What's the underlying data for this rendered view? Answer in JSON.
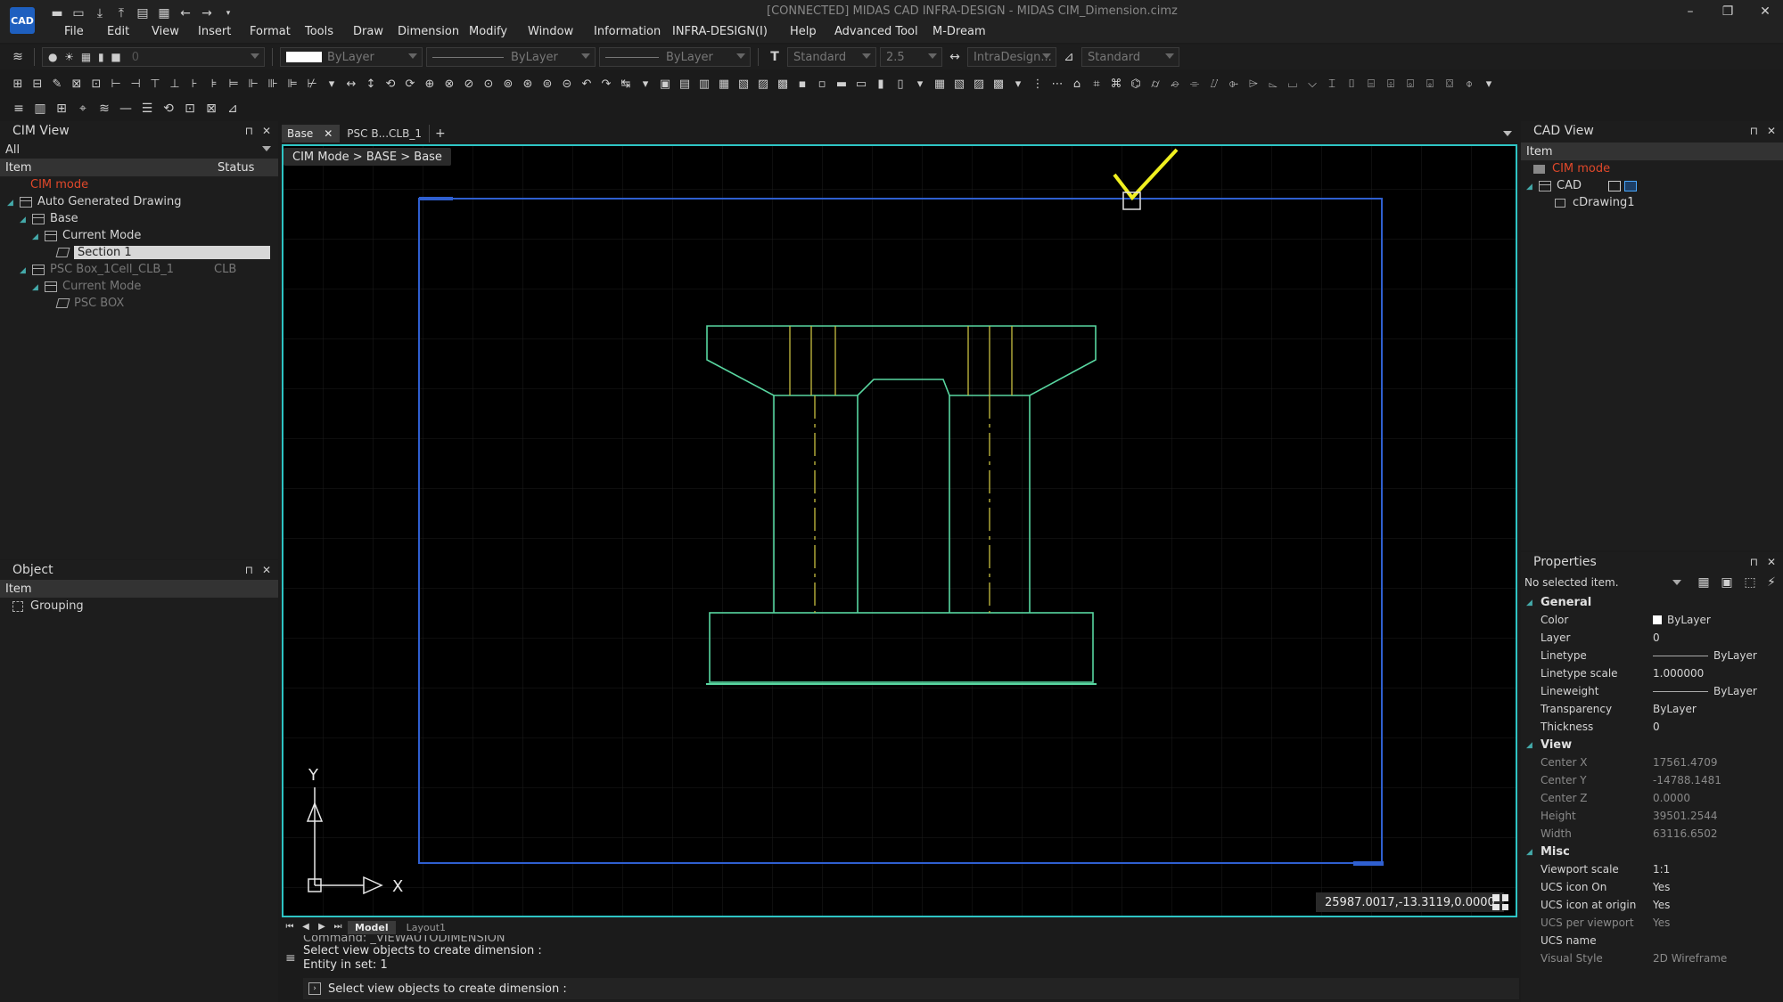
{
  "window": {
    "title": "[CONNECTED] MIDAS CAD INFRA-DESIGN - MIDAS CIM_Dimension.cimz",
    "logo": "CAD"
  },
  "menu": [
    "File",
    "Edit",
    "View",
    "Insert",
    "Format",
    "Tools",
    "Draw",
    "Dimension",
    "Modify",
    "Window",
    "Information",
    "INFRA-DESIGN(I)",
    "Help",
    "Advanced Tool",
    "M-Dream"
  ],
  "props_bar": {
    "layer_value": "0",
    "color_label": "ByLayer",
    "linetype_label": "ByLayer",
    "lineweight_label": "ByLayer",
    "text_style": "Standard",
    "text_height": "2.5",
    "dim_style": "IntraDesign...",
    "table_style": "Standard"
  },
  "cim_view": {
    "title": "CIM View",
    "filter": "All",
    "columns": {
      "item": "Item",
      "status": "Status"
    },
    "mode_label": "CIM mode",
    "tree": [
      {
        "label": "Auto Generated Drawing",
        "status": "",
        "level": 0,
        "dim": false
      },
      {
        "label": "Base",
        "status": "",
        "level": 1,
        "dim": false
      },
      {
        "label": "Current Mode",
        "status": "",
        "level": 2,
        "dim": false
      },
      {
        "label": "Section 1",
        "status": "",
        "level": 3,
        "dim": false,
        "selected": true
      },
      {
        "label": "PSC Box_1Cell_CLB_1",
        "status": "CLB",
        "level": 1,
        "dim": true
      },
      {
        "label": "Current Mode",
        "status": "",
        "level": 2,
        "dim": true
      },
      {
        "label": "PSC BOX",
        "status": "",
        "level": 3,
        "dim": true
      }
    ]
  },
  "object_panel": {
    "title": "Object",
    "column": "Item",
    "items": [
      "Grouping"
    ]
  },
  "tabs": [
    {
      "label": "Base",
      "active": true
    },
    {
      "label": "PSC B...CLB_1",
      "active": false
    }
  ],
  "add_tab": "+",
  "breadcrumb": "CIM Mode > BASE > Base",
  "coords": "25987.0017,-13.3119,0.0000",
  "ucs": {
    "x": "X",
    "y": "Y"
  },
  "layout_tabs": [
    "Model",
    "Layout1"
  ],
  "command": {
    "lines": [
      "Command: _VIEWAUTODIMENSION",
      "Select view objects to create dimension :",
      "Entity in set: 1"
    ],
    "prompt": "Select view objects to create dimension :"
  },
  "cad_view": {
    "title": "CAD View",
    "column": "Item",
    "mode_label": "CIM mode",
    "tree": [
      {
        "label": "CAD",
        "level": 0
      },
      {
        "label": "cDrawing1",
        "level": 1
      }
    ]
  },
  "properties": {
    "title": "Properties",
    "selection": "No selected item.",
    "groups": [
      {
        "name": "General",
        "rows": [
          {
            "k": "Color",
            "v": "ByLayer",
            "dim": false
          },
          {
            "k": "Layer",
            "v": "0",
            "dim": false
          },
          {
            "k": "Linetype",
            "v": "ByLayer",
            "dim": false
          },
          {
            "k": "Linetype scale",
            "v": "1.000000",
            "dim": false
          },
          {
            "k": "Lineweight",
            "v": "ByLayer",
            "dim": false
          },
          {
            "k": "Transparency",
            "v": "ByLayer",
            "dim": false
          },
          {
            "k": "Thickness",
            "v": "0",
            "dim": false
          }
        ]
      },
      {
        "name": "View",
        "rows": [
          {
            "k": "Center X",
            "v": "17561.4709",
            "dim": true
          },
          {
            "k": "Center Y",
            "v": "-14788.1481",
            "dim": true
          },
          {
            "k": "Center Z",
            "v": "0.0000",
            "dim": true
          },
          {
            "k": "Height",
            "v": "39501.2544",
            "dim": true
          },
          {
            "k": "Width",
            "v": "63116.6502",
            "dim": true
          }
        ]
      },
      {
        "name": "Misc",
        "rows": [
          {
            "k": "Viewport scale",
            "v": "1:1",
            "dim": false
          },
          {
            "k": "UCS icon On",
            "v": "Yes",
            "dim": false
          },
          {
            "k": "UCS icon at origin",
            "v": "Yes",
            "dim": false
          },
          {
            "k": "UCS per viewport",
            "v": "Yes",
            "dim": true
          },
          {
            "k": "UCS name",
            "v": "",
            "dim": false
          },
          {
            "k": "Visual Style",
            "v": "2D Wireframe",
            "dim": true
          }
        ]
      }
    ]
  },
  "colors": {
    "accent": "#2ec4c4",
    "drawing": "#58d6a0",
    "centerline": "#c8c040",
    "frame": "#2f5fd0",
    "mode": "#e0482a",
    "check": "#f0f020"
  }
}
